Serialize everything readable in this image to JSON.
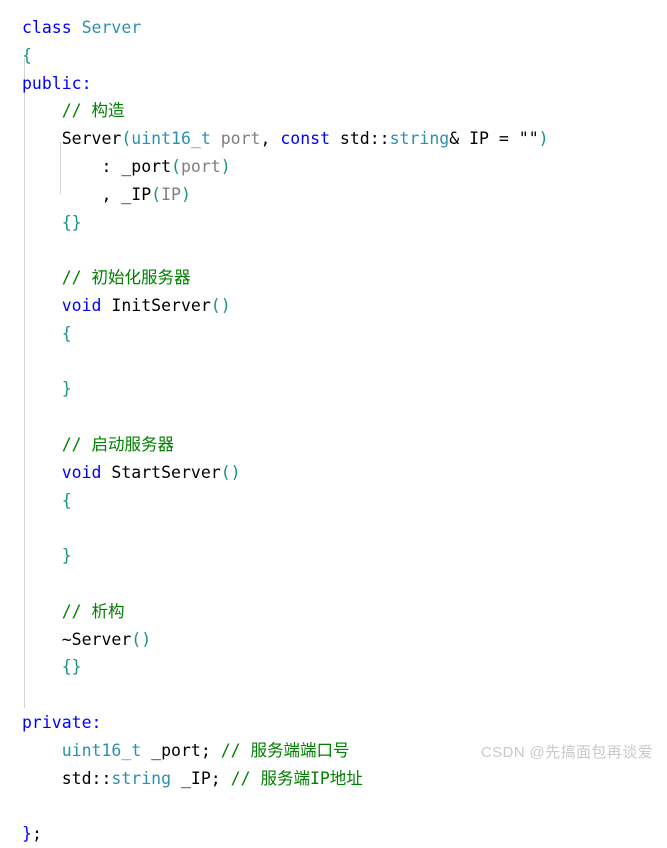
{
  "editor": {
    "language": "cpp",
    "background_color": "#ffffff",
    "indent_guide_color": "#d4d4d4",
    "palette": {
      "keyword": "#0000ff",
      "type": "#2b91af",
      "plain": "#000000",
      "parameter": "#808080",
      "comment": "#008000",
      "string": "#a31515",
      "bracket_level_1": "#179387",
      "bracket_level_2": "#b0a000"
    }
  },
  "code": {
    "lines": [
      {
        "id": "line-1",
        "text": "class Server"
      },
      {
        "id": "line-2",
        "text": "{"
      },
      {
        "id": "line-3",
        "text": "public:"
      },
      {
        "id": "line-4",
        "text": "    // 构造"
      },
      {
        "id": "line-5",
        "text": "    Server(uint16_t port, const std::string& IP = \"\")"
      },
      {
        "id": "line-6",
        "text": "        : _port(port)"
      },
      {
        "id": "line-7",
        "text": "        , _IP(IP)"
      },
      {
        "id": "line-8",
        "text": "    {}"
      },
      {
        "id": "line-9",
        "text": ""
      },
      {
        "id": "line-10",
        "text": "    // 初始化服务器"
      },
      {
        "id": "line-11",
        "text": "    void InitServer()"
      },
      {
        "id": "line-12",
        "text": "    {"
      },
      {
        "id": "line-13",
        "text": ""
      },
      {
        "id": "line-14",
        "text": "    }"
      },
      {
        "id": "line-15",
        "text": ""
      },
      {
        "id": "line-16",
        "text": "    // 启动服务器"
      },
      {
        "id": "line-17",
        "text": "    void StartServer()"
      },
      {
        "id": "line-18",
        "text": "    {"
      },
      {
        "id": "line-19",
        "text": ""
      },
      {
        "id": "line-20",
        "text": "    }"
      },
      {
        "id": "line-21",
        "text": ""
      },
      {
        "id": "line-22",
        "text": "    // 析构"
      },
      {
        "id": "line-23",
        "text": "    ~Server()"
      },
      {
        "id": "line-24",
        "text": "    {}"
      },
      {
        "id": "line-25",
        "text": ""
      },
      {
        "id": "line-26",
        "text": "private:"
      },
      {
        "id": "line-27",
        "text": "    uint16_t _port; // 服务端端口号"
      },
      {
        "id": "line-28",
        "text": "    std::string _IP; // 服务端IP地址"
      },
      {
        "id": "line-29",
        "text": ""
      },
      {
        "id": "line-30",
        "text": "};"
      }
    ],
    "tokens": {
      "line1": {
        "kw_class": "class",
        "sp": " ",
        "type_server": "Server"
      },
      "line2": {
        "brace_open": "{"
      },
      "line3": {
        "kw_public": "public:"
      },
      "line4": {
        "comment": "// 构造"
      },
      "line5": {
        "name": "Server",
        "paren_open": "(",
        "type_uint16": "uint16_t",
        "param_port": " port",
        "comma": ", ",
        "kw_const": "const",
        "std_ns": " std::",
        "type_string": "string",
        "amp_ip": "& IP = ",
        "empty_string": "\"\"",
        "paren_close": ")"
      },
      "line6": {
        "colon": ": ",
        "member": "_port",
        "paren_open": "(",
        "arg": "port",
        "paren_close": ")"
      },
      "line7": {
        "comma": ", ",
        "member": "_IP",
        "paren_open": "(",
        "arg": "IP",
        "paren_close": ")"
      },
      "line8": {
        "braces": "{}"
      },
      "line10": {
        "comment": "// 初始化服务器"
      },
      "line11": {
        "kw_void": "void",
        "name": " InitServer",
        "paren_open": "(",
        "paren_close": ")"
      },
      "line12": {
        "brace_open": "{"
      },
      "line14": {
        "brace_close": "}"
      },
      "line16": {
        "comment": "// 启动服务器"
      },
      "line17": {
        "kw_void": "void",
        "name": " StartServer",
        "paren_open": "(",
        "paren_close": ")"
      },
      "line18": {
        "brace_open": "{"
      },
      "line20": {
        "brace_close": "}"
      },
      "line22": {
        "comment": "// 析构"
      },
      "line23": {
        "name": "~Server",
        "paren_open": "(",
        "paren_close": ")"
      },
      "line24": {
        "braces": "{}"
      },
      "line26": {
        "kw_private": "private:"
      },
      "line27": {
        "type_uint16": "uint16_t",
        "member": " _port; ",
        "comment": "// 服务端端口号"
      },
      "line28": {
        "std_ns": "std::",
        "type_string": "string",
        "member": " _IP; ",
        "comment": "// 服务端IP地址"
      },
      "line30": {
        "brace_close": "}",
        "semicolon": ";"
      }
    }
  },
  "watermark": {
    "text": "CSDN @先搞面包再谈爱"
  }
}
